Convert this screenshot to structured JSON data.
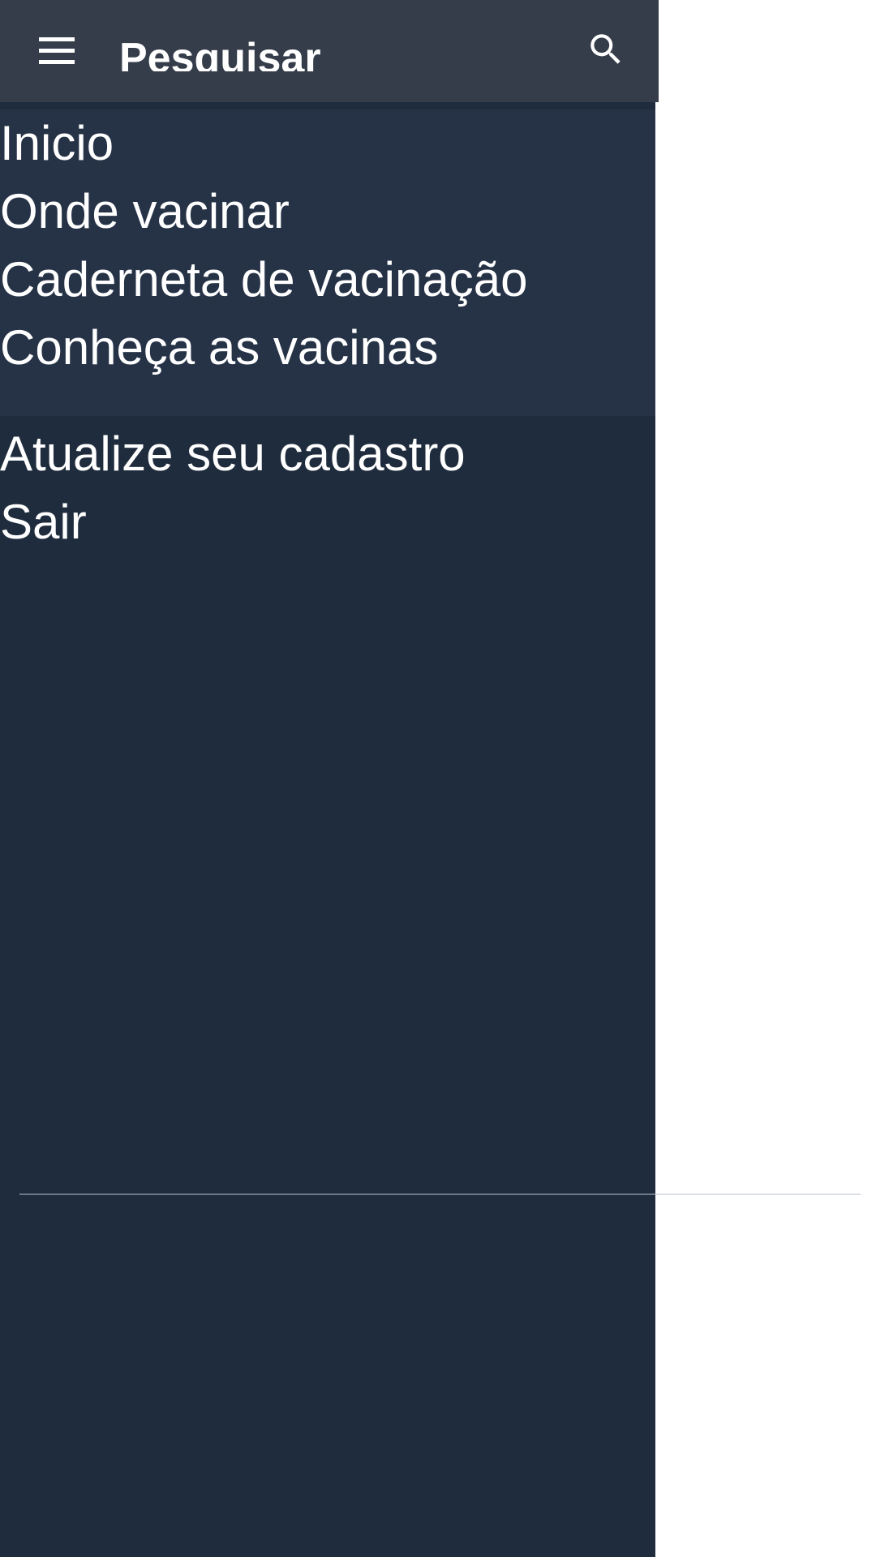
{
  "app_bar": {
    "title": "Pesquisar",
    "menu_icon": "hamburger-menu-icon",
    "search_icon": "search-icon",
    "background": "#353d4a"
  },
  "drawer": {
    "primary_items": [
      {
        "label": "Inicio"
      },
      {
        "label": "Onde vacinar"
      },
      {
        "label": "Caderneta de vacinação"
      },
      {
        "label": "Conheça as vacinas"
      }
    ],
    "secondary_items": [
      {
        "label": "Atualize seu cadastro"
      },
      {
        "label": "Sair"
      }
    ],
    "primary_background": "#263347",
    "background": "#1f2c3d"
  }
}
